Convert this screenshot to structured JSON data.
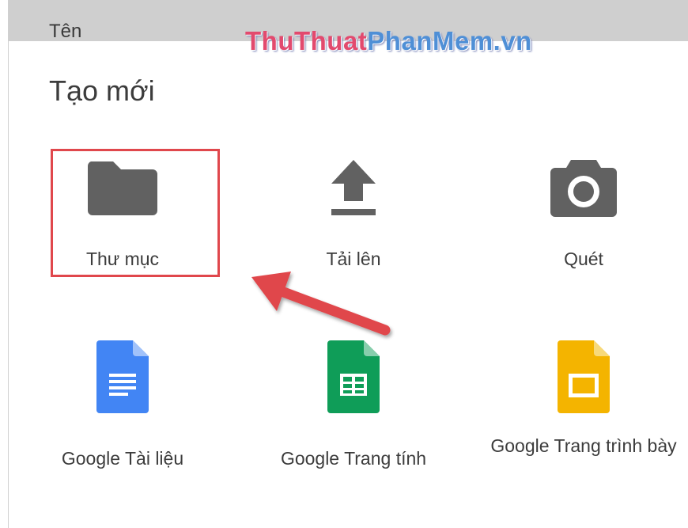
{
  "background_label": "Tên",
  "watermark": {
    "part_red": "ThuThuat",
    "part_blue": "PhanMem.vn"
  },
  "sheet": {
    "title": "Tạo mới",
    "items": [
      {
        "id": "folder",
        "label": "Thư mục",
        "icon": "folder-icon"
      },
      {
        "id": "upload",
        "label": "Tải lên",
        "icon": "upload-icon"
      },
      {
        "id": "scan",
        "label": "Quét",
        "icon": "camera-icon"
      },
      {
        "id": "docs",
        "label": "Google Tài liệu",
        "icon": "google-docs-icon"
      },
      {
        "id": "sheets",
        "label": "Google Trang tính",
        "icon": "google-sheets-icon"
      },
      {
        "id": "slides",
        "label": "Google Trang trình bày",
        "icon": "google-slides-icon"
      }
    ]
  },
  "colors": {
    "icon_gray": "#616161",
    "docs_blue": "#4285f4",
    "sheets_green": "#0f9d58",
    "slides_yellow": "#f4b400",
    "highlight_red": "#e0474c"
  }
}
